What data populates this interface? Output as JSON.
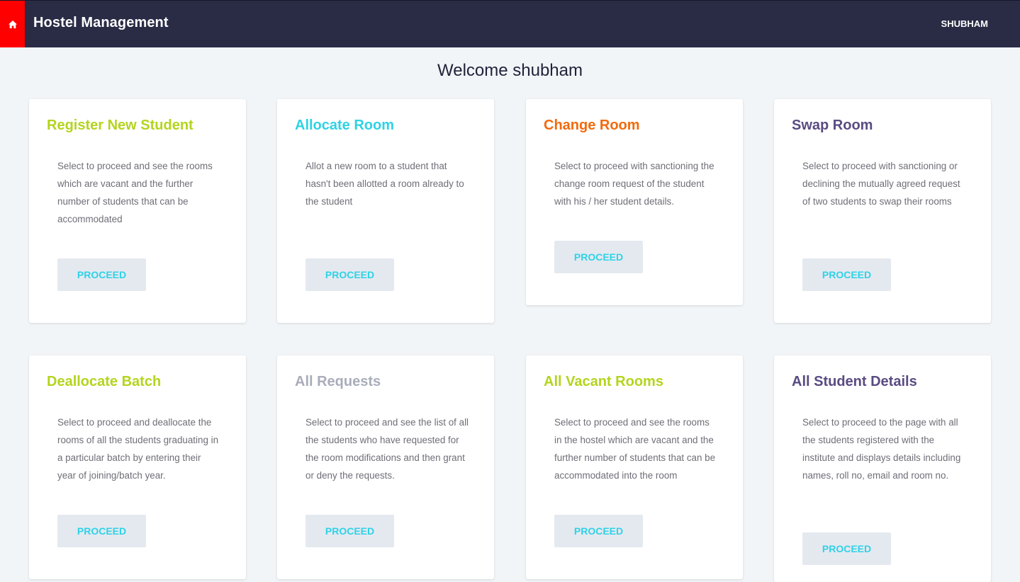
{
  "navbar": {
    "home_icon": "home-icon",
    "brand": "Hostel Management",
    "user": "SHUBHAM",
    "home_color": "#ff0000",
    "bg_color": "#2a2b45"
  },
  "welcome": "Welcome shubham",
  "cards": [
    {
      "title": "Register New Student",
      "title_color": "#b4d41e",
      "description": "Select to proceed and see the rooms which are vacant and the further number of students that can be accommodated",
      "button": "PROCEED"
    },
    {
      "title": "Allocate Room",
      "title_color": "#2fd2e6",
      "description": "Allot a new room to a student that hasn't been allotted a room already to the student",
      "button": "PROCEED"
    },
    {
      "title": "Change Room",
      "title_color": "#f26a0d",
      "description": "Select to proceed with sanctioning the change room request of the student with his / her student details.",
      "button": "PROCEED"
    },
    {
      "title": "Swap Room",
      "title_color": "#5a4b82",
      "description": "Select to proceed with sanctioning or declining the mutually agreed request of two students to swap their rooms",
      "button": "PROCEED"
    },
    {
      "title": "Deallocate Batch",
      "title_color": "#b4d41e",
      "description": "Select to proceed and deallocate the rooms of all the students graduating in a particular batch by entering their year of joining/batch year.",
      "button": "PROCEED"
    },
    {
      "title": "All Requests",
      "title_color": "#a9adba",
      "description": "Select to proceed and see the list of all the students who have requested for the room modifications and then grant or deny the requests.",
      "button": "PROCEED"
    },
    {
      "title": "All Vacant Rooms",
      "title_color": "#b4d41e",
      "description": "Select to proceed and see the rooms in the hostel which are vacant and the further number of students that can be accommodated into the room",
      "button": "PROCEED"
    },
    {
      "title": "All Student Details",
      "title_color": "#5a4b82",
      "description": "Select to proceed to the page with all the students registered with the institute and displays details including names, roll no, email and room no.",
      "button": "PROCEED"
    }
  ]
}
